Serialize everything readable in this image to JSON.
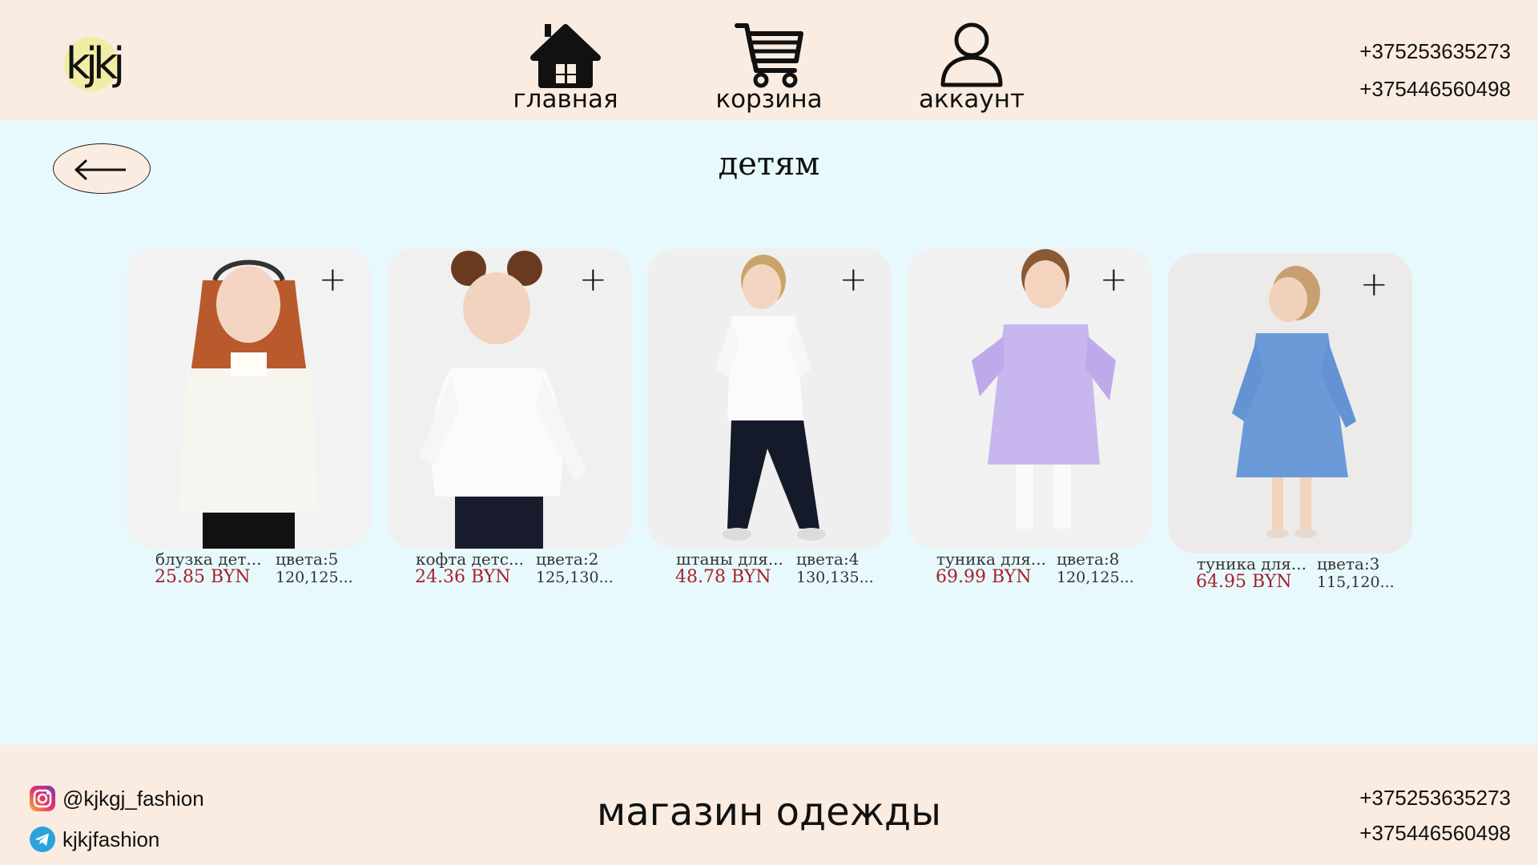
{
  "header": {
    "logo_text": "kjkj",
    "nav": [
      {
        "label": "главная",
        "icon": "home-icon"
      },
      {
        "label": "корзина",
        "icon": "cart-icon"
      },
      {
        "label": "аккаунт",
        "icon": "user-icon"
      }
    ],
    "phones": [
      "+375253635273",
      "+375446560498"
    ]
  },
  "page": {
    "title": "детям",
    "back_icon": "arrow-left-icon"
  },
  "products": [
    {
      "name": "блузка дет...",
      "price": "25.85 BYN",
      "colors": "цвета:5",
      "sizes": "120,125...",
      "image": "girl in white knit blouse"
    },
    {
      "name": "кофта детс...",
      "price": "24.36 BYN",
      "colors": "цвета:2",
      "sizes": "125,130...",
      "image": "girl in white long-sleeve top"
    },
    {
      "name": "штаны для...",
      "price": "48.78 BYN",
      "colors": "цвета:4",
      "sizes": "130,135...",
      "image": "boy in white shirt and navy trousers"
    },
    {
      "name": "туника для...",
      "price": "69.99 BYN",
      "colors": "цвета:8",
      "sizes": "120,125...",
      "image": "girl in lilac tunic"
    },
    {
      "name": "туника для...",
      "price": "64.95 BYN",
      "colors": "цвета:3",
      "sizes": "115,120...",
      "image": "girl in blue tunic"
    }
  ],
  "footer": {
    "instagram": "@kjkgj_fashion",
    "telegram": "kjkjfashion",
    "title": "магазин одежды",
    "phones": [
      "+375253635273",
      "+375446560498"
    ]
  },
  "colors": {
    "header_bg": "#fbece1",
    "body_bg": "#e8f9fd",
    "price": "#a6202c",
    "logo_blob": "#f1eca6"
  }
}
